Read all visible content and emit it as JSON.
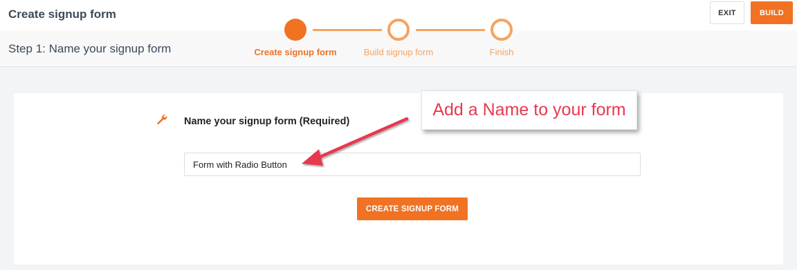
{
  "header": {
    "title": "Create signup form",
    "exit_label": "EXIT",
    "build_label": "BUILD"
  },
  "subheader": {
    "step_title": "Step 1: Name your signup form"
  },
  "stepper": {
    "steps": [
      {
        "label": "Create signup form",
        "state": "active"
      },
      {
        "label": "Build signup form",
        "state": "pending"
      },
      {
        "label": "Finish",
        "state": "pending"
      }
    ]
  },
  "form": {
    "field_label": "Name your signup form (Required)",
    "field_icon": "wrench-icon",
    "name_value": "Form with Radio Button",
    "create_label": "CREATE SIGNUP FORM"
  },
  "annotation": {
    "text": "Add a Name to your form"
  },
  "colors": {
    "accent": "#f07222",
    "accent_light": "#f5a35f",
    "annotation": "#e8384f"
  }
}
